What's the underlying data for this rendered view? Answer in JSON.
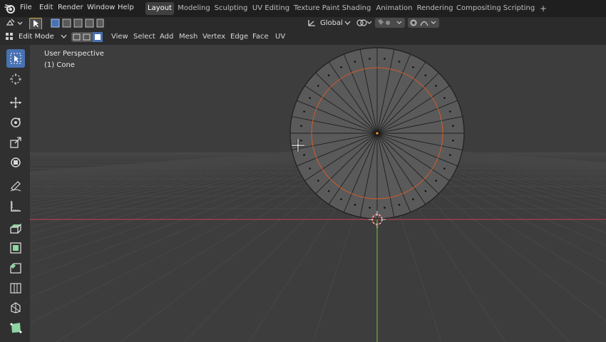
{
  "app": {
    "logo_icon": "blender-logo-icon"
  },
  "top_menu": {
    "items": [
      "File",
      "Edit",
      "Render",
      "Window",
      "Help"
    ]
  },
  "workspace_tabs": {
    "items": [
      "Layout",
      "Modeling",
      "Sculpting",
      "UV Editing",
      "Texture Paint",
      "Shading",
      "Animation",
      "Rendering",
      "Compositing",
      "Scripting"
    ],
    "active": "Layout",
    "add_label": "+"
  },
  "header": {
    "mode_select": "Edit Mode",
    "menus": [
      "View",
      "Select",
      "Add",
      "Mesh",
      "Vertex",
      "Edge",
      "Face",
      "UV"
    ],
    "transform_orientation": "Global"
  },
  "viewport": {
    "view_name": "User Perspective",
    "object_name": "(1) Cone",
    "x_axis_color": "#a8424b",
    "y_axis_color": "#64a233",
    "active_edges_color": "#d35a2a"
  },
  "toolbar": {
    "tools": [
      "select-box-icon",
      "cursor-icon",
      "move-icon",
      "rotate-icon",
      "scale-icon",
      "transform-icon",
      "annotate-icon",
      "measure-icon",
      "extrude-region-icon",
      "inset-faces-icon",
      "bevel-icon",
      "loop-cut-icon",
      "knife-icon",
      "poly-build-icon"
    ],
    "active_tool": "select-box-icon"
  }
}
